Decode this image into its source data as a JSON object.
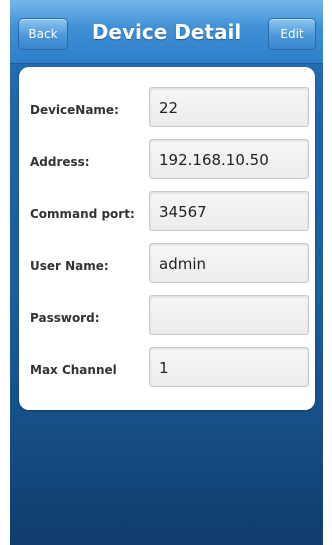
{
  "header": {
    "back_label": "Back",
    "title": "Device Detail",
    "edit_label": "Edit"
  },
  "form": {
    "fields": [
      {
        "label": "DeviceName:",
        "value": "22"
      },
      {
        "label": "Address:",
        "value": "192.168.10.50"
      },
      {
        "label": "Command port:",
        "value": "34567"
      },
      {
        "label": "User Name:",
        "value": "admin"
      },
      {
        "label": "Password:",
        "value": ""
      },
      {
        "label": "Max Channel",
        "value": "1"
      }
    ]
  },
  "colors": {
    "navbar": "#3f8fd6",
    "background_top": "#2a74b6",
    "background_bottom": "#0f3d6d",
    "card": "#ffffff"
  }
}
